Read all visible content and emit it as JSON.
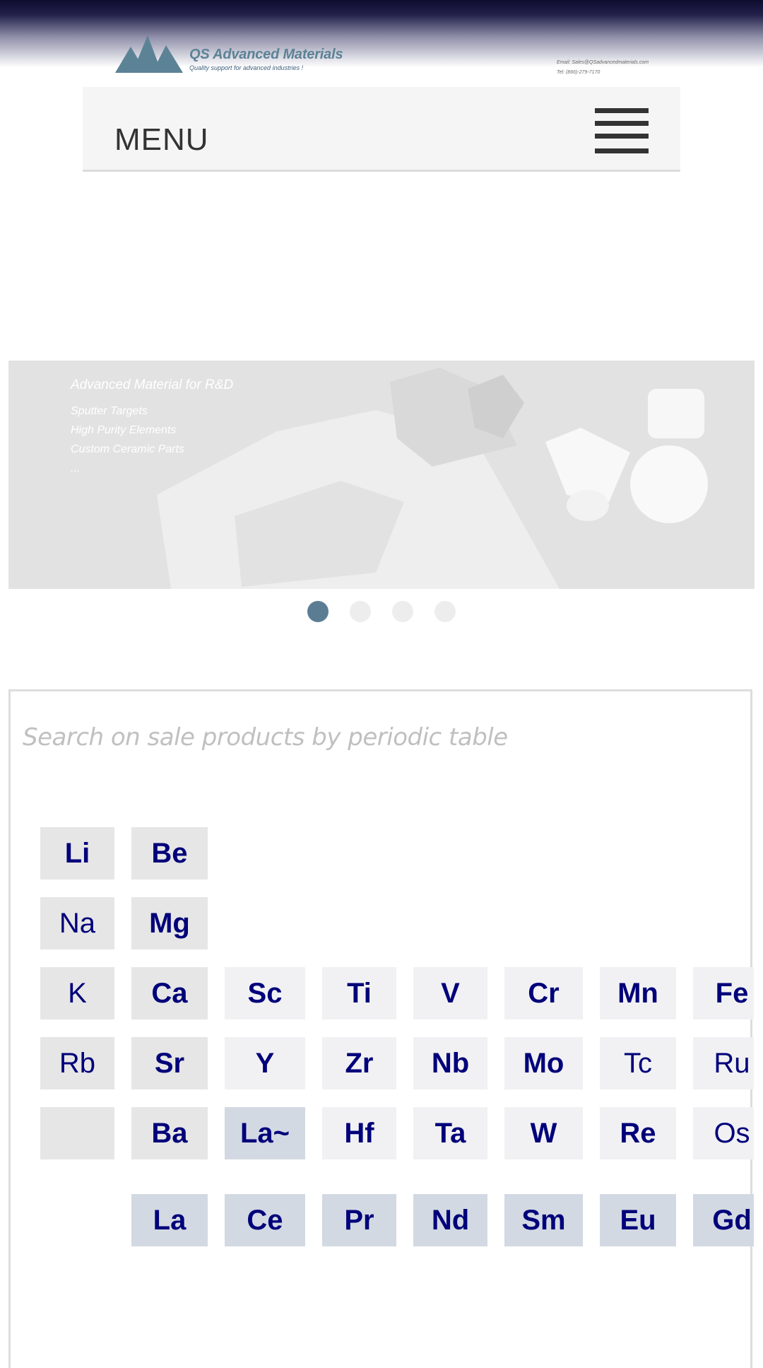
{
  "header": {
    "logo_name": "QS Advanced Materials",
    "logo_tagline": "Quality support for advanced industries !",
    "email": "Email: Sales@QSadvancedmaterials.com",
    "phone": "Tel: (866)-279-7170"
  },
  "menu": {
    "label": "MENU"
  },
  "carousel": {
    "headline": "Advanced Material for R&D",
    "lines": [
      "Sputter Targets",
      "High Purity Elements",
      "Custom Ceramic Parts",
      "..."
    ],
    "dot_count": 4,
    "active_index": 0
  },
  "periodic_search": {
    "title": "Search on sale products by periodic table",
    "elements": {
      "Li": "Li",
      "Be": "Be",
      "Na": "Na",
      "Mg": "Mg",
      "K": "K",
      "Ca": "Ca",
      "Sc": "Sc",
      "Ti": "Ti",
      "V": "V",
      "Cr": "Cr",
      "Mn": "Mn",
      "Fe": "Fe",
      "Rb": "Rb",
      "Sr": "Sr",
      "Y": "Y",
      "Zr": "Zr",
      "Nb": "Nb",
      "Mo": "Mo",
      "Tc": "Tc",
      "Ru": "Ru",
      "Ba": "Ba",
      "Lanthanides": "La~",
      "Hf": "Hf",
      "Ta": "Ta",
      "W": "W",
      "Re": "Re",
      "Os": "Os",
      "La": "La",
      "Ce": "Ce",
      "Pr": "Pr",
      "Nd": "Nd",
      "Sm": "Sm",
      "Eu": "Eu",
      "Gd": "Gd"
    }
  },
  "colors": {
    "element_text": "#00007a",
    "active_dot": "#5b7d94",
    "logo": "#5c8296"
  }
}
